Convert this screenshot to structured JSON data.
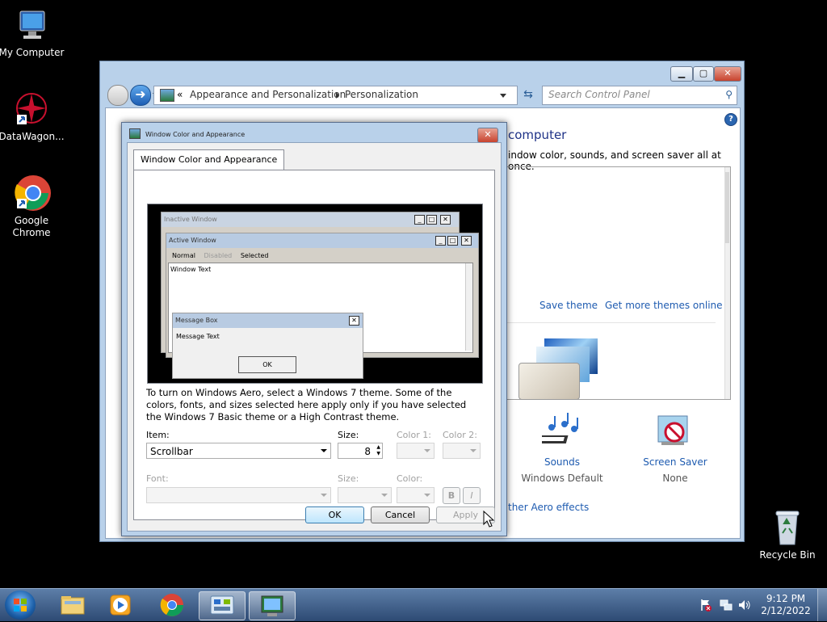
{
  "desktop": {
    "icons": [
      {
        "label": "My Computer"
      },
      {
        "label": "DataWagon..."
      },
      {
        "label": "Google Chrome"
      },
      {
        "label": "Recycle Bin"
      }
    ]
  },
  "control_panel": {
    "breadcrumb_sep": "«",
    "breadcrumb": [
      "Appearance and Personalization",
      "Personalization"
    ],
    "search_placeholder": "Search Control Panel",
    "heading_fragment": "computer",
    "subtitle_fragment": "indow color, sounds, and screen saver all at once.",
    "save_theme": "Save theme",
    "get_more_themes": "Get more themes online",
    "sounds_label": "Sounds",
    "sounds_value": "Windows Default",
    "screensaver_label": "Screen Saver",
    "screensaver_value": "None",
    "aero_link_fragment": "ther Aero effects",
    "help_glyph": "?"
  },
  "dialog": {
    "title": "Window Color and Appearance",
    "tab": "Window Color and Appearance",
    "preview": {
      "inactive_title": "Inactive Window",
      "active_title": "Active Window",
      "menu": [
        "Normal",
        "Disabled",
        "Selected"
      ],
      "window_text": "Window Text",
      "msgbox_title": "Message Box",
      "msgbox_text": "Message Text",
      "msgbox_ok": "OK"
    },
    "info_text": "To turn on Windows Aero, select a Windows 7 theme.  Some of the colors, fonts, and sizes selected here apply only if you have selected the Windows 7 Basic theme or a High Contrast theme.",
    "item_label": "Item:",
    "item_value": "Scrollbar",
    "size_label": "Size:",
    "size_value": "8",
    "color1_label": "Color 1:",
    "color2_label": "Color 2:",
    "font_label": "Font:",
    "font_size_label": "Size:",
    "font_color_label": "Color:",
    "bold_label": "B",
    "italic_label": "I",
    "ok_label": "OK",
    "cancel_label": "Cancel",
    "apply_label": "Apply"
  },
  "taskbar": {
    "time": "9:12 PM",
    "date": "2/12/2022"
  }
}
